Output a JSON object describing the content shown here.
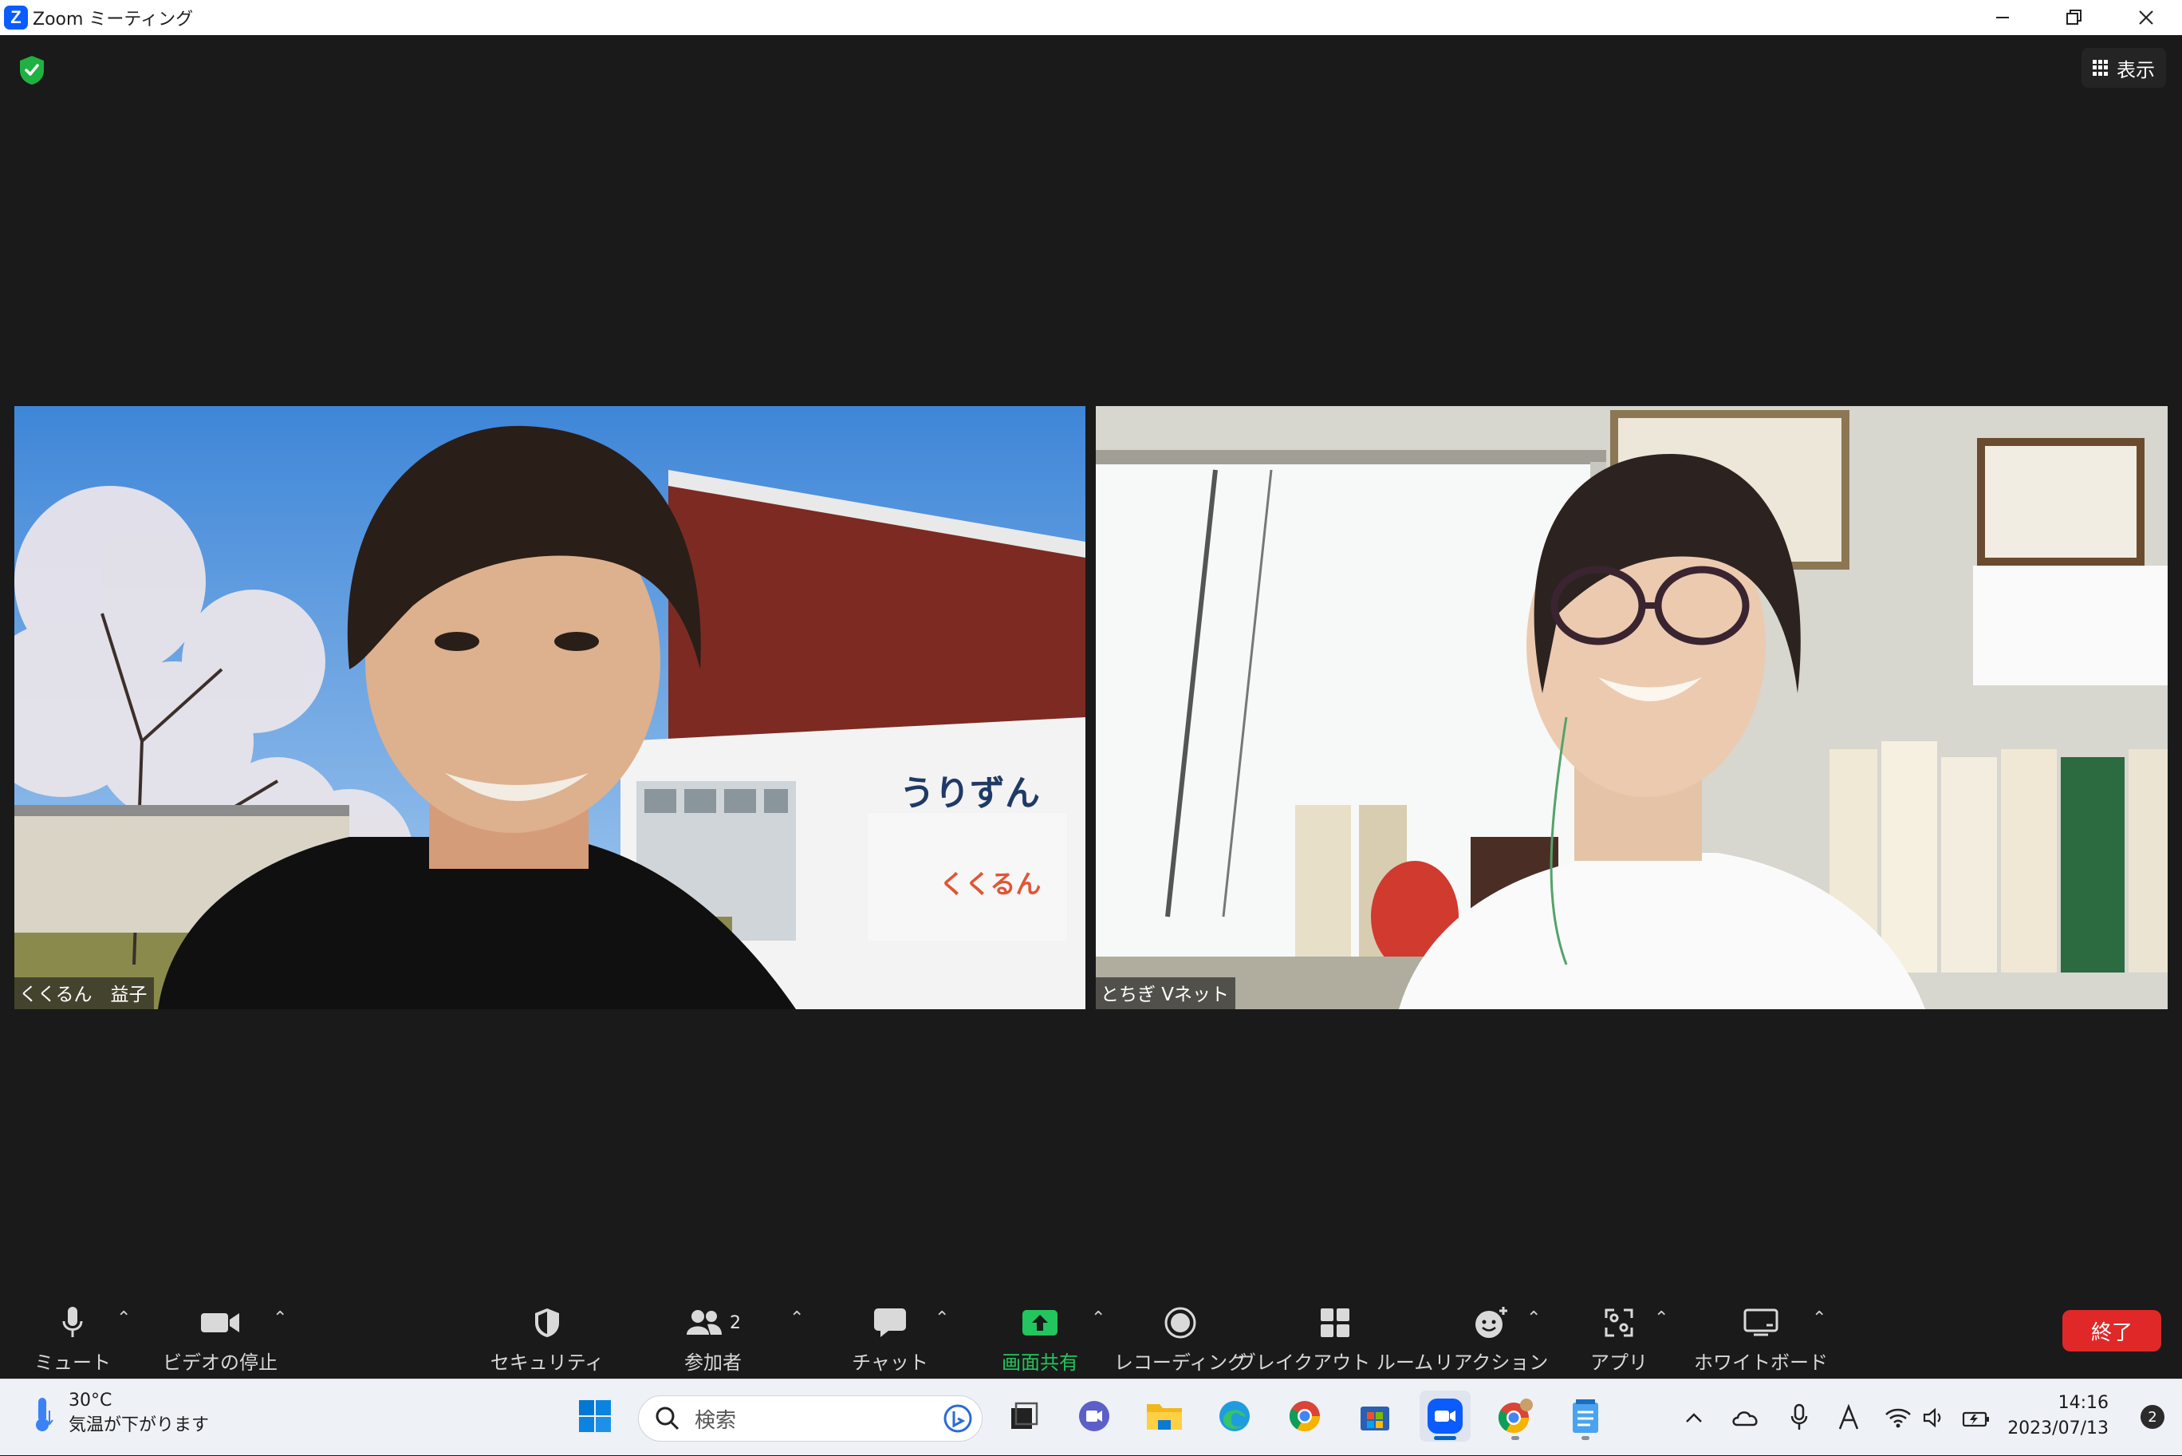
{
  "window": {
    "title": "Zoom ミーティング",
    "logo_letter": "Z"
  },
  "top_bar": {
    "view_label": "表示"
  },
  "participants": [
    {
      "name": "くくるん　益子"
    },
    {
      "name": "とちぎ Vネット"
    }
  ],
  "scene_text": {
    "sign_main": "うりずん",
    "sign_sub": "くくるん"
  },
  "toolbar": {
    "mute_label": "ミュート",
    "video_label": "ビデオの停止",
    "security_label": "セキュリティ",
    "participants_label": "参加者",
    "participants_count": "2",
    "chat_label": "チャット",
    "share_label": "画面共有",
    "record_label": "レコーディング",
    "breakout_label": "ブレイクアウト ルーム",
    "reactions_label": "リアクション",
    "apps_label": "アプリ",
    "whiteboard_label": "ホワイトボード",
    "end_label": "終了"
  },
  "taskbar": {
    "weather_temp": "30°C",
    "weather_desc": "気温が下がります",
    "search_placeholder": "検索",
    "clock_time": "14:16",
    "clock_date": "2023/07/13",
    "notification_count": "2"
  },
  "colors": {
    "share_green": "#22c55e",
    "end_red": "#e02828",
    "zoom_blue": "#0b5cff"
  }
}
